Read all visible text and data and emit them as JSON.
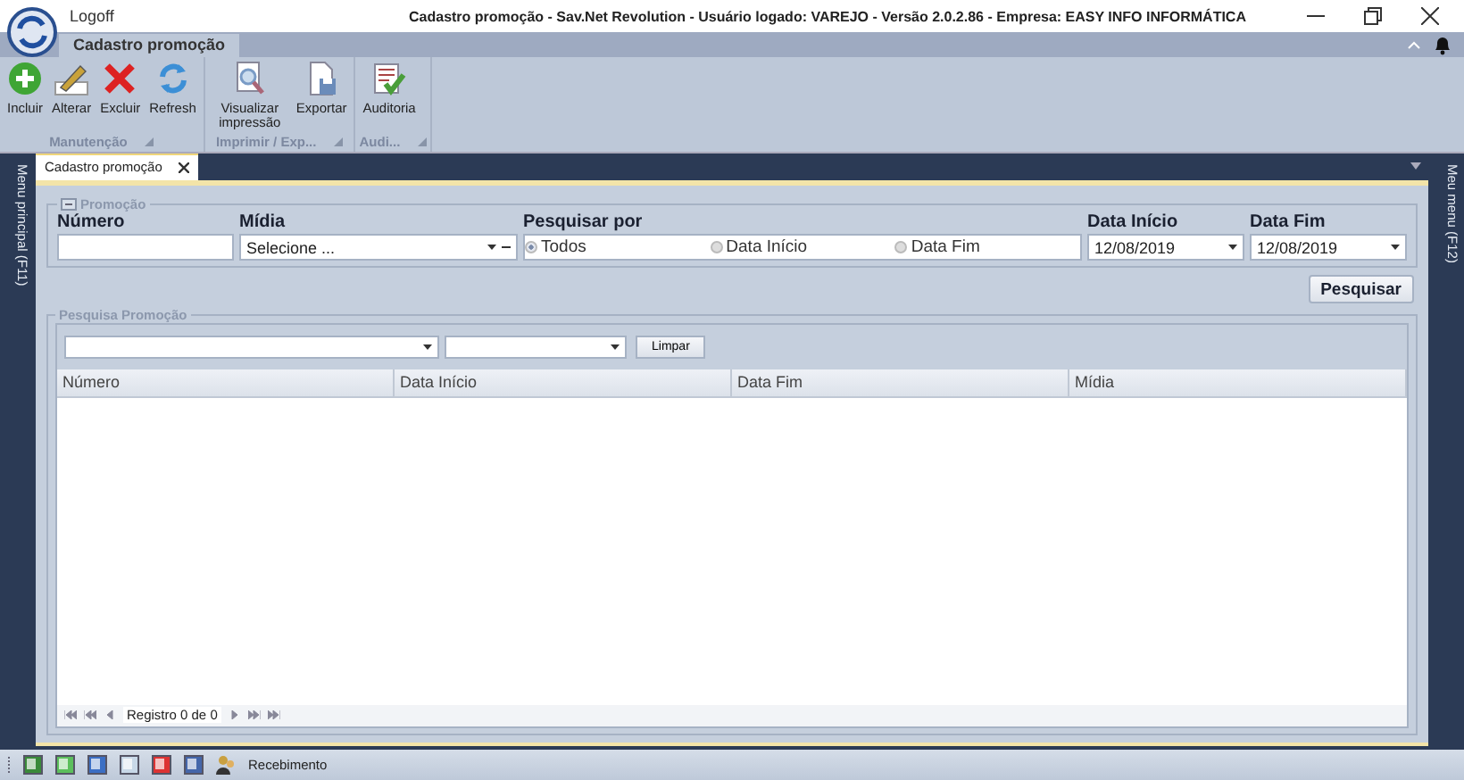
{
  "window": {
    "title": "Cadastro promoção - Sav.Net Revolution - Usuário logado: VAREJO - Versão 2.0.2.86 - Empresa: EASY INFO INFORMÁTICA",
    "logoff": "Logoff"
  },
  "ribbon": {
    "tabs": [
      {
        "label": "Cadastro promoção",
        "selected": true
      }
    ],
    "groups": [
      {
        "label": "Manutenção",
        "buttons": [
          {
            "label": "Incluir",
            "kind": "add"
          },
          {
            "label": "Alterar",
            "kind": "edit"
          },
          {
            "label": "Excluir",
            "kind": "delete"
          },
          {
            "label": "Refresh",
            "kind": "refresh"
          }
        ]
      },
      {
        "label": "Imprimir / Exp...",
        "buttons": [
          {
            "label": "Visualizar impressão",
            "kind": "preview"
          },
          {
            "label": "Exportar",
            "kind": "export"
          }
        ]
      },
      {
        "label": "Audi...",
        "buttons": [
          {
            "label": "Auditoria",
            "kind": "audit"
          }
        ]
      }
    ]
  },
  "side_left": "Menu principal (F11)",
  "side_right": "Meu menu (F12)",
  "doc_tabs": [
    {
      "label": "Cadastro promoção",
      "selected": true
    }
  ],
  "promocao": {
    "legend": "Promoção",
    "numero": {
      "label": "Número"
    },
    "midia": {
      "label": "Mídia",
      "value": "Selecione ..."
    },
    "pesquisar_por": {
      "label": "Pesquisar por",
      "options": [
        {
          "label": "Todos",
          "selected": true
        },
        {
          "label": "Data Início",
          "selected": false
        },
        {
          "label": "Data Fim",
          "selected": false
        }
      ]
    },
    "data_inicio": {
      "label": "Data Início",
      "value": "12/08/2019"
    },
    "data_fim": {
      "label": "Data Fim",
      "value": "12/08/2019"
    }
  },
  "search_button": "Pesquisar",
  "pesquisa": {
    "legend": "Pesquisa Promoção",
    "clear_button": "Limpar",
    "columns": [
      "Número",
      "Data Início",
      "Data Fim",
      "Mídia"
    ],
    "pager": "Registro 0 de 0"
  },
  "status_bar": {
    "label": "Recebimento"
  }
}
